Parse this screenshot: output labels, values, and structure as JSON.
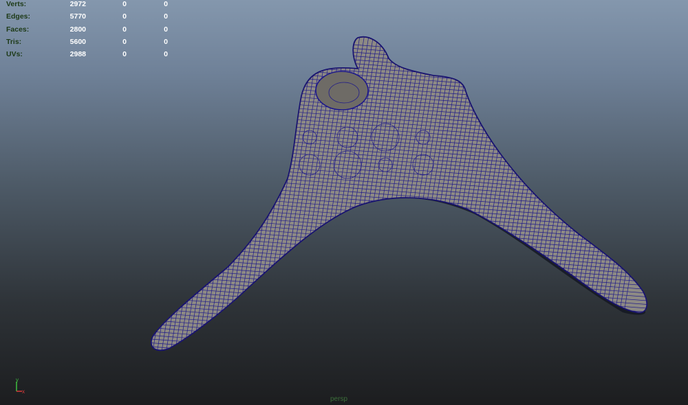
{
  "heads_up_display": {
    "rows": [
      {
        "label": "Verts:",
        "values": [
          "2972",
          "0",
          "0"
        ]
      },
      {
        "label": "Edges:",
        "values": [
          "5770",
          "0",
          "0"
        ]
      },
      {
        "label": "Faces:",
        "values": [
          "2800",
          "0",
          "0"
        ]
      },
      {
        "label": "Tris:",
        "values": [
          "5600",
          "0",
          "0"
        ]
      },
      {
        "label": "UVs:",
        "values": [
          "2988",
          "0",
          "0"
        ]
      }
    ]
  },
  "axis_gizmo": {
    "y_label": "y",
    "x_label": "x",
    "x_color": "#d83a3a",
    "y_color": "#3fbf3f"
  },
  "camera": {
    "name": "persp"
  },
  "colors": {
    "wireframe": "#1f1a8a",
    "surface": "#8d8a84",
    "background_top": "#8497ad",
    "background_bottom": "#1c1d1f"
  }
}
